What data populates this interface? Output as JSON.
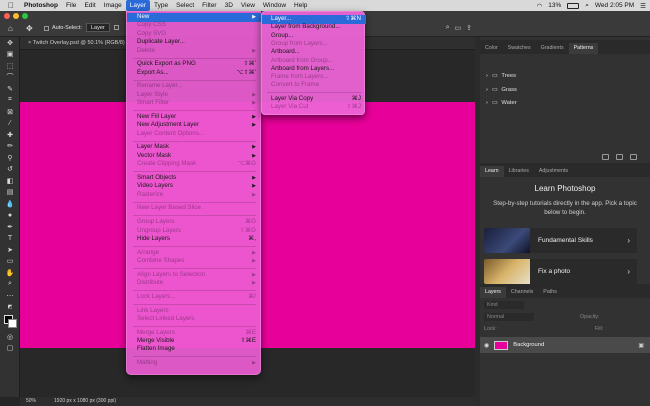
{
  "menubar": {
    "apple_icon": "apple-logo-icon",
    "app": "Photoshop",
    "items": [
      "File",
      "Edit",
      "Image",
      "Layer",
      "Type",
      "Select",
      "Filter",
      "3D",
      "View",
      "Window",
      "Help"
    ],
    "active": "Layer",
    "battery": "13%",
    "clock": "Wed 2:05 PM"
  },
  "options": {
    "auto_select_label": "Auto-Select:",
    "auto_select_value": "Layer"
  },
  "document": {
    "tab_title": "Twitch Overlay.psd @ 50.1% (RGB/8)",
    "canvas_color": "#e8009a"
  },
  "status": {
    "zoom": "50%",
    "doc_info": "1920 px x 1080 px (300 ppi)"
  },
  "layer_menu": [
    {
      "label": "New",
      "hl": true,
      "arrow": true
    },
    {
      "label": "Copy CSS",
      "dis": true
    },
    {
      "label": "Copy SVG",
      "dis": true
    },
    {
      "label": "Duplicate Layer..."
    },
    {
      "label": "Delete",
      "dis": true,
      "arrow": true
    },
    {
      "sep": true
    },
    {
      "label": "Quick Export as PNG",
      "sc": "⇧⌘'"
    },
    {
      "label": "Export As...",
      "sc": "⌥⇧⌘'"
    },
    {
      "sep": true
    },
    {
      "label": "Rename Layer...",
      "dis": true
    },
    {
      "label": "Layer Style",
      "dis": true,
      "arrow": true
    },
    {
      "label": "Smart Filter",
      "dis": true,
      "arrow": true
    },
    {
      "sep": true
    },
    {
      "label": "New Fill Layer",
      "arrow": true
    },
    {
      "label": "New Adjustment Layer",
      "arrow": true
    },
    {
      "label": "Layer Content Options...",
      "dis": true
    },
    {
      "sep": true
    },
    {
      "label": "Layer Mask",
      "arrow": true
    },
    {
      "label": "Vector Mask",
      "arrow": true
    },
    {
      "label": "Create Clipping Mask",
      "dis": true,
      "sc": "⌥⌘G"
    },
    {
      "sep": true
    },
    {
      "label": "Smart Objects",
      "arrow": true
    },
    {
      "label": "Video Layers",
      "arrow": true
    },
    {
      "label": "Rasterize",
      "dis": true,
      "arrow": true
    },
    {
      "sep": true
    },
    {
      "label": "New Layer Based Slice",
      "dis": true
    },
    {
      "sep": true
    },
    {
      "label": "Group Layers",
      "dis": true,
      "sc": "⌘G"
    },
    {
      "label": "Ungroup Layers",
      "dis": true,
      "sc": "⇧⌘G"
    },
    {
      "label": "Hide Layers",
      "sc": "⌘,"
    },
    {
      "sep": true
    },
    {
      "label": "Arrange",
      "dis": true,
      "arrow": true
    },
    {
      "label": "Combine Shapes",
      "dis": true,
      "arrow": true
    },
    {
      "sep": true
    },
    {
      "label": "Align Layers to Selection",
      "dis": true,
      "arrow": true
    },
    {
      "label": "Distribute",
      "dis": true,
      "arrow": true
    },
    {
      "sep": true
    },
    {
      "label": "Lock Layers...",
      "dis": true,
      "sc": "⌘/"
    },
    {
      "sep": true
    },
    {
      "label": "Link Layers",
      "dis": true
    },
    {
      "label": "Select Linked Layers",
      "dis": true
    },
    {
      "sep": true
    },
    {
      "label": "Merge Layers",
      "dis": true,
      "sc": "⌘E"
    },
    {
      "label": "Merge Visible",
      "sc": "⇧⌘E"
    },
    {
      "label": "Flatten Image"
    },
    {
      "sep": true
    },
    {
      "label": "Matting",
      "dis": true,
      "arrow": true
    }
  ],
  "new_submenu": [
    {
      "label": "Layer...",
      "hl": true,
      "sc": "⇧⌘N"
    },
    {
      "label": "Layer from Background..."
    },
    {
      "label": "Group..."
    },
    {
      "label": "Group from Layers...",
      "dis": true
    },
    {
      "label": "Artboard..."
    },
    {
      "label": "Artboard from Group...",
      "dis": true
    },
    {
      "label": "Artboard from Layers..."
    },
    {
      "label": "Frame from Layers...",
      "dis": true
    },
    {
      "label": "Convert to Frame",
      "dis": true
    },
    {
      "sep": true
    },
    {
      "label": "Layer Via Copy",
      "sc": "⌘J"
    },
    {
      "label": "Layer Via Cut",
      "dis": true,
      "sc": "⇧⌘J"
    }
  ],
  "patterns_panel": {
    "tabs": [
      "Color",
      "Swatches",
      "Gradients",
      "Patterns"
    ],
    "active": "Patterns",
    "folders": [
      "Trees",
      "Grass",
      "Water"
    ]
  },
  "learn_panel": {
    "tabs": [
      "Learn",
      "Libraries",
      "Adjustments"
    ],
    "active": "Learn",
    "title": "Learn Photoshop",
    "description": "Step-by-step tutorials directly in the app. Pick a topic below to begin.",
    "cards": [
      "Fundamental Skills",
      "Fix a photo"
    ]
  },
  "layers_panel": {
    "tabs": [
      "Layers",
      "Channels",
      "Paths"
    ],
    "active": "Layers",
    "kind": "Kind",
    "blend": "Normal",
    "opacity_label": "Opacity:",
    "lock_label": "Lock:",
    "fill_label": "Fill:",
    "layer_name": "Background"
  }
}
